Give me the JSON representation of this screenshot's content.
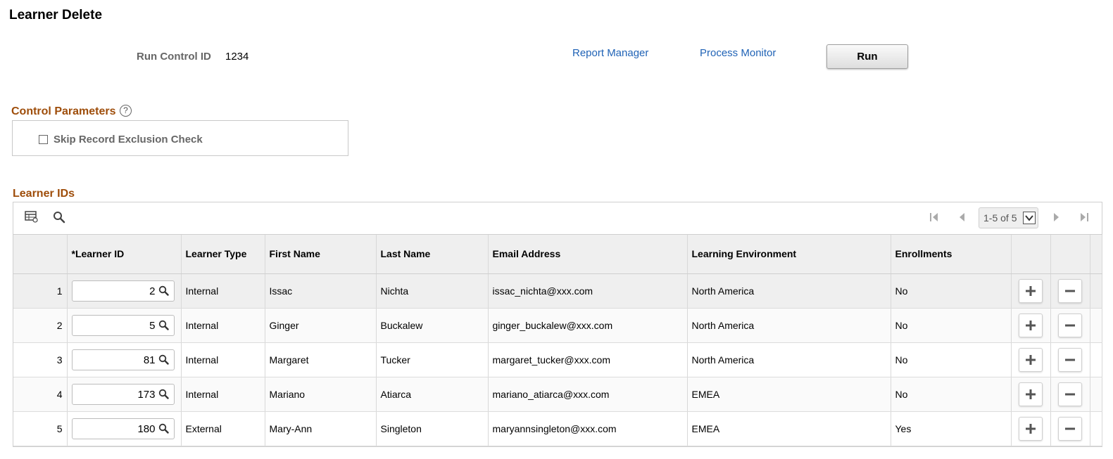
{
  "page": {
    "title": "Learner Delete"
  },
  "run_control": {
    "label": "Run Control ID",
    "value": "1234"
  },
  "links": {
    "report_manager": "Report Manager",
    "process_monitor": "Process Monitor"
  },
  "run_button": {
    "label": "Run"
  },
  "control_parameters": {
    "title": "Control Parameters",
    "help_icon": "?",
    "skip_check": {
      "label": "Skip Record Exclusion Check",
      "checked": false
    }
  },
  "learner_ids": {
    "title": "Learner IDs",
    "pagination": {
      "label": "1-5 of 5"
    },
    "columns": [
      "*Learner ID",
      "Learner Type",
      "First Name",
      "Last Name",
      "Email Address",
      "Learning Environment",
      "Enrollments"
    ],
    "rows": [
      {
        "num": "1",
        "id": "2",
        "type": "Internal",
        "first": "Issac",
        "last": "Nichta",
        "email": "issac_nichta@xxx.com",
        "env": "North America",
        "enrollments": "No"
      },
      {
        "num": "2",
        "id": "5",
        "type": "Internal",
        "first": "Ginger",
        "last": "Buckalew",
        "email": "ginger_buckalew@xxx.com",
        "env": "North America",
        "enrollments": "No"
      },
      {
        "num": "3",
        "id": "81",
        "type": "Internal",
        "first": "Margaret",
        "last": "Tucker",
        "email": "margaret_tucker@xxx.com",
        "env": "North America",
        "enrollments": "No"
      },
      {
        "num": "4",
        "id": "173",
        "type": "Internal",
        "first": "Mariano",
        "last": "Atiarca",
        "email": "mariano_atiarca@xxx.com",
        "env": "EMEA",
        "enrollments": "No"
      },
      {
        "num": "5",
        "id": "180",
        "type": "External",
        "first": "Mary-Ann",
        "last": "Singleton",
        "email": "maryannsingleton@xxx.com",
        "env": "EMEA",
        "enrollments": "Yes"
      }
    ]
  },
  "icons": {
    "grid_view": "table-icon",
    "grid_find": "search-icon",
    "first": "first-page-icon",
    "prev": "previous-page-icon",
    "next": "next-page-icon",
    "last": "last-page-icon",
    "lookup": "lookup-search-icon",
    "add": "plus-icon",
    "delete": "minus-icon"
  },
  "colors": {
    "section_title": "#9e4d0a",
    "link": "#2063b6"
  }
}
